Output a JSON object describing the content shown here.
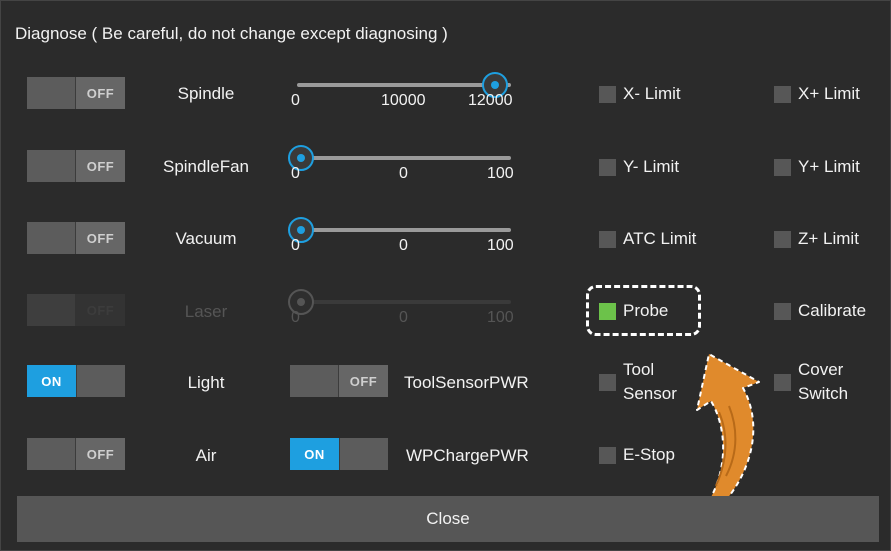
{
  "dialog": {
    "title": "Diagnose ( Be careful, do not change except diagnosing )",
    "close_label": "Close"
  },
  "toggles": {
    "off_text": "OFF",
    "on_text": "ON"
  },
  "outputs": [
    {
      "label": "Spindle",
      "state": "OFF",
      "enabled": true
    },
    {
      "label": "SpindleFan",
      "state": "OFF",
      "enabled": true
    },
    {
      "label": "Vacuum",
      "state": "OFF",
      "enabled": true
    },
    {
      "label": "Laser",
      "state": "OFF",
      "enabled": false
    },
    {
      "label": "Light",
      "state": "ON",
      "enabled": true
    },
    {
      "label": "Air",
      "state": "OFF",
      "enabled": true
    }
  ],
  "sliders": [
    {
      "name": "spindle",
      "min_label": "0",
      "mid_label": "10000",
      "max_label": "12000",
      "value": 12000,
      "max": 12000,
      "enabled": true
    },
    {
      "name": "spindle-fan",
      "min_label": "0",
      "mid_label": "0",
      "max_label": "100",
      "value": 0,
      "max": 100,
      "enabled": true
    },
    {
      "name": "vacuum",
      "min_label": "0",
      "mid_label": "0",
      "max_label": "100",
      "value": 0,
      "max": 100,
      "enabled": true
    },
    {
      "name": "laser",
      "min_label": "0",
      "mid_label": "0",
      "max_label": "100",
      "value": 0,
      "max": 100,
      "enabled": false
    }
  ],
  "extra_outputs": [
    {
      "label": "ToolSensorPWR",
      "state": "OFF"
    },
    {
      "label": "WPChargePWR",
      "state": "ON"
    }
  ],
  "inputs_left": [
    {
      "label": "X- Limit",
      "checked": false
    },
    {
      "label": "Y- Limit",
      "checked": false
    },
    {
      "label": "ATC Limit",
      "checked": false
    },
    {
      "label": "Probe",
      "checked": true
    },
    {
      "label": "Tool\nSensor",
      "checked": false
    },
    {
      "label": "E-Stop",
      "checked": false
    }
  ],
  "inputs_right": [
    {
      "label": "X+ Limit",
      "checked": false
    },
    {
      "label": "Y+ Limit",
      "checked": false
    },
    {
      "label": "Z+ Limit",
      "checked": false
    },
    {
      "label": "Calibrate",
      "checked": false
    },
    {
      "label": "Cover\nSwitch",
      "checked": false
    }
  ],
  "colors": {
    "accent": "#1e9fe0",
    "checked": "#6cc24a",
    "annotation_arrow": "#e08a2c",
    "background": "#2b2b2b"
  },
  "annotation": {
    "highlight_target": "Probe",
    "arrow_icon": "curved-arrow-icon"
  }
}
